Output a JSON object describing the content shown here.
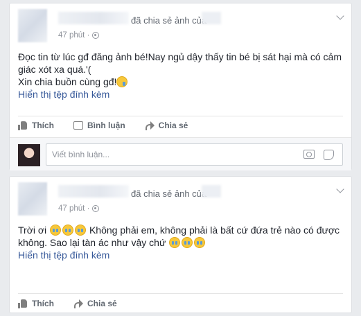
{
  "posts": [
    {
      "header": {
        "shared_action": "đã chia sẻ ảnh của",
        "time": "47 phút ·"
      },
      "body": {
        "line1": "Đọc tin từ lúc gđ đăng ảnh bé!Nay ngủ dậy thấy tin bé bị sát hại mà có cảm giác xót xa quá.'(",
        "line2": "Xin chia buồn cùng gđ!",
        "show_attachment": "Hiển thị tệp đính kèm"
      },
      "actions": {
        "like": "Thích",
        "comment": "Bình luận",
        "share": "Chia sẻ"
      },
      "comment_placeholder": "Viết bình luận..."
    },
    {
      "header": {
        "shared_action": "đã chia sẻ ảnh của",
        "time": "47 phút ·"
      },
      "body": {
        "line1_a": "Trời ơi",
        "line1_b": "Không phải em, không phải là bất cứ đứa trẻ nào có được không. Sao lại tàn ác như vậy chứ",
        "show_attachment": "Hiển thị tệp đính kèm"
      },
      "actions": {
        "like": "Thích",
        "share": "Chia sẻ"
      }
    }
  ],
  "icons": [
    "globe-icon",
    "chevron-down-icon",
    "like-icon",
    "comment-icon",
    "share-icon",
    "camera-icon",
    "sticker-icon",
    "crying-emoji-icon",
    "sad-emoji-icon"
  ],
  "colors": {
    "link": "#365899",
    "meta": "#90949c",
    "background": "#e9ebee"
  }
}
